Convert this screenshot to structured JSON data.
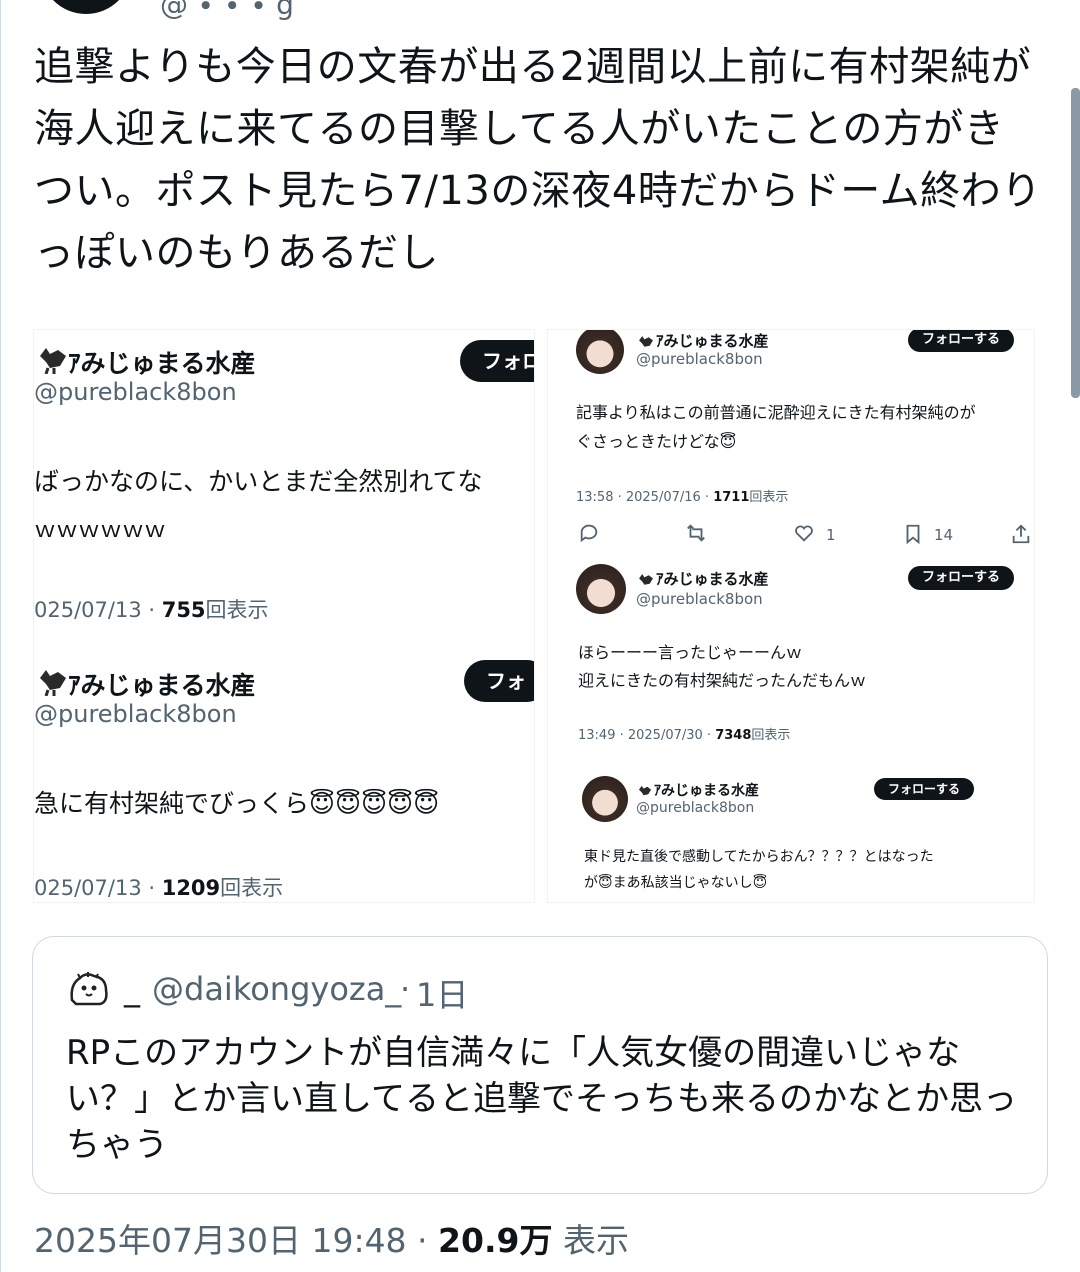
{
  "header": {
    "handle": "@ ∙ ∙ ∙ g"
  },
  "tweet": {
    "text": "追撃よりも今日の文春が出る2週間以上前に有村架純が海人迎えに来てるの目撃してる人がいたことの方がきつい。ポスト見たら7/13の深夜4時だからドーム終わりっぽいのもりあるだし"
  },
  "image_left": {
    "post1": {
      "name": "ｱみじゅまる水産",
      "handle": "@pureblack8bon",
      "follow": "フォロ",
      "text1": "ばっかなのに、かいとまだ全然別れてな",
      "text2": "ｗｗｗｗｗｗ",
      "date": "025/07/13 · ",
      "views": "755",
      "views_label": "回表示"
    },
    "post2": {
      "name": "ｱみじゅまる水産",
      "handle": "@pureblack8bon",
      "follow": "フォ",
      "text": "急に有村架純でびっくら😇😇😇😇😇",
      "date": "025/07/13 · ",
      "views": "1209",
      "views_label": "回表示"
    }
  },
  "image_right": {
    "post1": {
      "name": "ｱみじゅまる水産",
      "handle": "@pureblack8bon",
      "follow": "フォローする",
      "line1": "記事より私はこの前普通に泥酔迎えにきた有村架純のが",
      "line2": "ぐさっときたけどな😇",
      "date": "13:58 · 2025/07/16 · ",
      "views": "1711",
      "views_label": "回表示",
      "likes": "1",
      "bookmarks": "14"
    },
    "post2": {
      "name": "ｱみじゅまる水産",
      "handle": "@pureblack8bon",
      "follow": "フォローする",
      "line1": "ほらーーー言ったじゃーーんｗ",
      "line2": "迎えにきたの有村架純だったんだもんｗ",
      "date": "13:49 · 2025/07/30 · ",
      "views": "7348",
      "views_label": "回表示"
    },
    "post3": {
      "name": "ｱみじゅまる水産",
      "handle": "@pureblack8bon",
      "follow": "フォローする",
      "line1": "東ド見た直後で感動してたからおん？？？？とはなった",
      "line2": "が😇まあ私該当じゃないし😇"
    }
  },
  "quote": {
    "name": "_",
    "handle": "@daikongyoza_",
    "dot": "·",
    "time": "1日",
    "text": "RPこのアカウントが自信満々に「人気女優の間違いじゃない？」とか言い直してると追撃でそっちも来るのかなとか思っちゃう"
  },
  "footer": {
    "datetime": "2025年07月30日 19:48 · ",
    "views": "20.9万",
    "views_label": " 表示"
  }
}
